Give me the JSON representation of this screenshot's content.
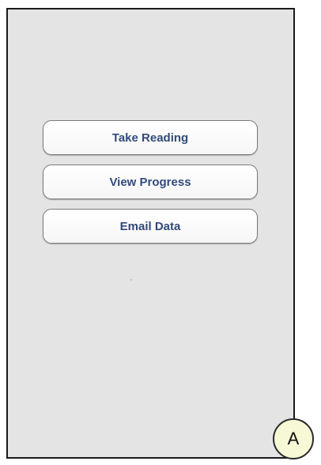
{
  "menu": {
    "buttons": [
      {
        "label": "Take Reading"
      },
      {
        "label": "View Progress"
      },
      {
        "label": "Email Data"
      }
    ]
  },
  "annotation": {
    "label": "A"
  },
  "colors": {
    "screen_background": "#e4e4e4",
    "button_text": "#324a7a",
    "badge_fill": "#f6f8d6"
  }
}
